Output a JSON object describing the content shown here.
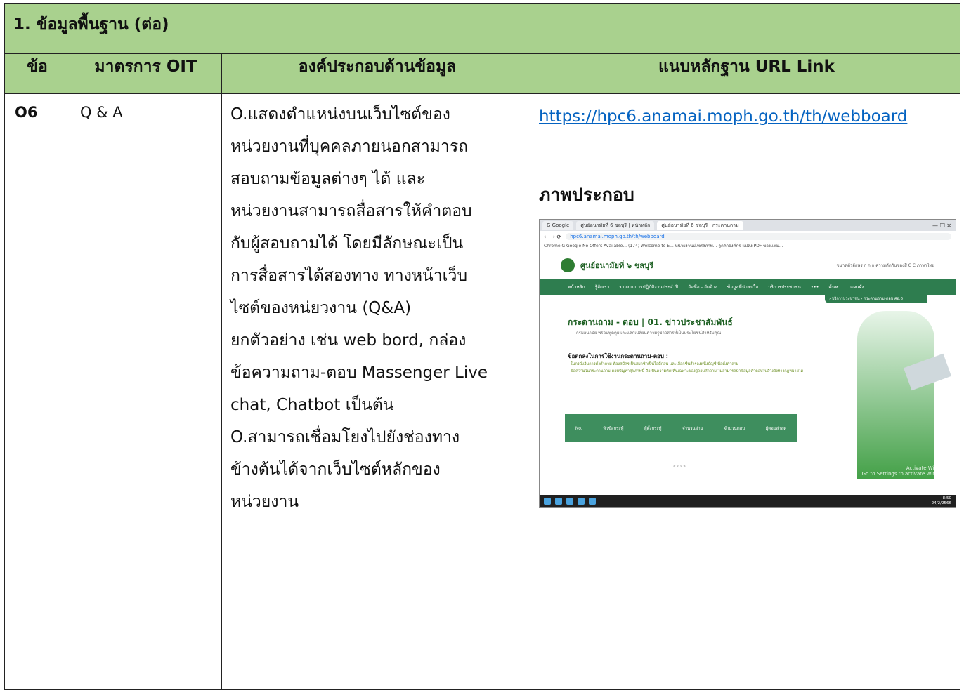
{
  "section_title": "1. ข้อมูลพื้นฐาน (ต่อ)",
  "columns": [
    "ข้อ",
    "มาตรการ OIT",
    "องค์ประกอบด้านข้อมูล",
    "แนบหลักฐาน URL Link"
  ],
  "row": {
    "no": "O6",
    "measure": "Q & A",
    "element_lines": [
      "O.แสดงตำแหน่งบนเว็บไซต์ของ",
      "หน่วยงานที่บุคคลภายนอกสามารถ",
      "สอบถามข้อมูลต่างๆ ได้ และ",
      "หน่วยงานสามารถสื่อสารให้คำตอบ",
      "กับผู้สอบถามได้ โดยมีลักษณะเป็น",
      "การสื่อสารได้สองทาง ทางหน้าเว็บ",
      "ไซต์ของหน่ยวงาน (Q&A)",
      "ยกตัวอย่าง เช่น web bord, กล่อง",
      "ข้อความถาม-ตอบ Massenger Live",
      "chat, Chatbot เป็นต้น",
      "O.สามารถเชื่อมโยงไปยังช่องทาง",
      "ข้างต้นได้จากเว็บไซต์หลักของ",
      "หน่วยงาน"
    ],
    "url": "https://hpc6.anamai.moph.go.th/th/webboard",
    "figure_label": "ภาพประกอบ"
  },
  "screenshot": {
    "tabs": [
      "G Google",
      "ศูนย์อนามัยที่ 6 ชลบุรี | หน้าหลัก",
      "ศูนย์อนามัยที่ 6 ชลบุรี | กระดานถาม"
    ],
    "address": "hpc6.anamai.moph.go.th/th/webboard",
    "bookmarks": "Chrome   G Google   No Offers Available...   (174) Welcome to E...   หน่วยงานมีเพศสภาพ...   ลูกค้าองค์กร   แปลง PDF ของแฟ้ม...",
    "site_name": "ศูนย์อนามัยที่ ๖ ชลบุรี",
    "site_tools": "ขนาดตัวอักษร  ก  ก  ก   ความตัดกันของสี  C  C   ภาษาไทย",
    "nav": [
      "หน้าหลัก",
      "รู้จักเรา",
      "รายงานการปฏิบัติงานประจำปี",
      "จัดซื้อ - จัดจ้าง",
      "ข้อมูลที่น่าสนใจ",
      "บริการประชาชน",
      "•••",
      "ค้นหา",
      "แผนผัง"
    ],
    "crumb": "› บริการประชาชน  ›  กระดานถาม-ตอบ ศอ.6",
    "qa_title": "กระดานถาม - ตอบ | 01. ข่าวประชาสัมพันธ์",
    "qa_sub": "กรมอนามัย พร้อมพูดคุยและแลกเปลี่ยนความรู้ข่าวสารที่เป็นประโยชน์สำหรับคุณ",
    "login": "เข้าสู่ระบบ   สมัครสมาชิก",
    "rules_title": "ข้อตกลงในการใช้งานกระดานถาม-ตอบ :",
    "rules": [
      "ในกรณีเริ่มการตั้งคำถาม ต้องสมัครเป็นสมาชิกเป็นไอดีก่อน และเลือกชื่นสำรองหนึ่งบัญชีเพื่อตั้งคำถาม",
      "ข้อความในกระดานถาม-ตอบปัญหาสุขภาพนี้ ถือเป็นความคิดเห็นเฉพาะของผู้ถอบคำถาม ไม่สามารถนำข้อมูลคำตอบไปอ้างอิงทางกฎหมายได้"
    ],
    "grid_cols": [
      "No.",
      "หัวข้อกระทู้",
      "ผู้ตั้งกระทู้",
      "จำนวนอ่าน",
      "จำนวนตอบ",
      "ผู้ตอบล่าสุด"
    ],
    "pager": "«  ‹  ›  »",
    "activate": "Activate Windows\nGo to Settings to activate Windows.",
    "clock": "8:50\n24/2/2566"
  }
}
